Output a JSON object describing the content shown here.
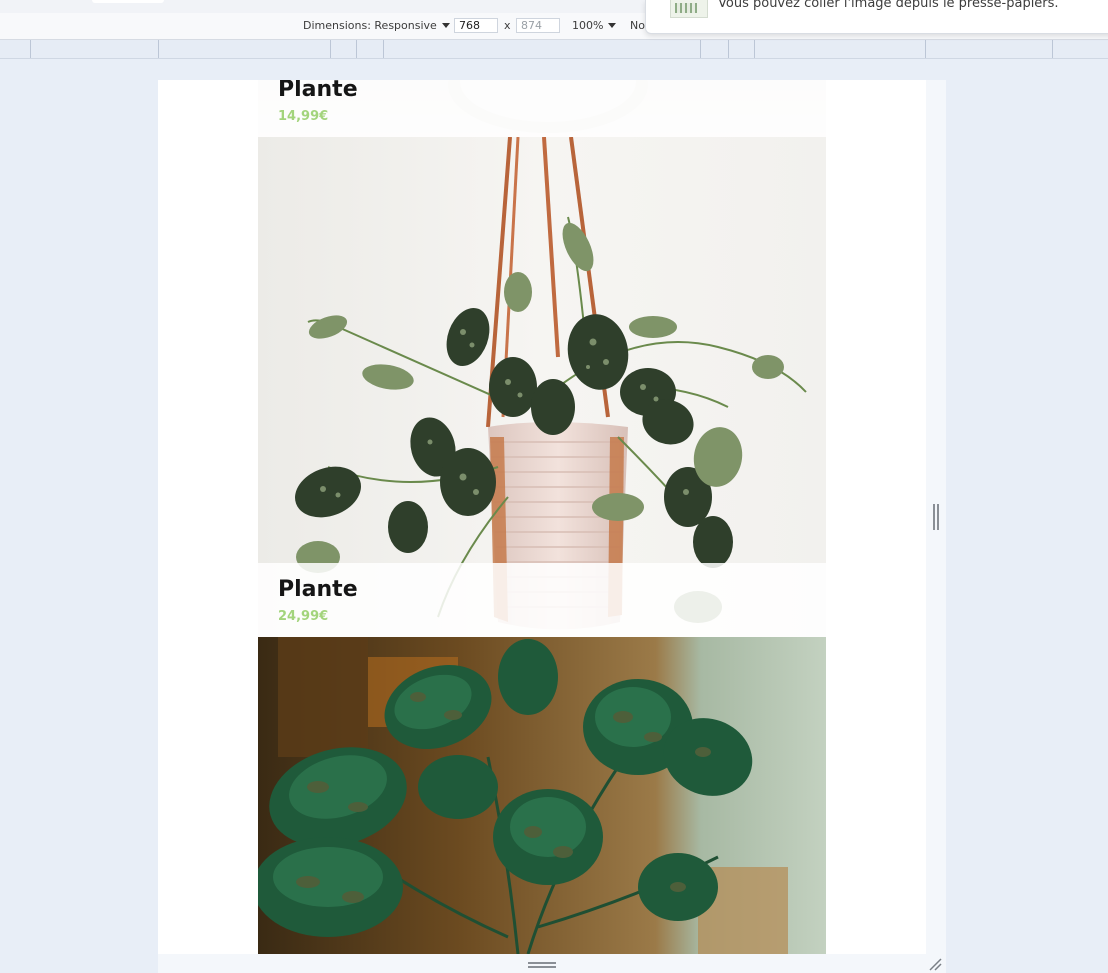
{
  "toolbar": {
    "dimensions_label": "Dimensions: Responsive",
    "width_value": "768",
    "times": "x",
    "height_placeholder": "874",
    "zoom": "100%",
    "throttle_label": "No"
  },
  "notification": {
    "message": "Vous pouvez coller l'image depuis le presse-papiers."
  },
  "products": [
    {
      "name": "Plante",
      "price": "14,99€"
    },
    {
      "name": "Plante",
      "price": "24,99€"
    }
  ],
  "colors": {
    "price_accent": "#a3d47c",
    "viewport_bg": "#ffffff",
    "devtools_bg": "#e8eef7"
  }
}
